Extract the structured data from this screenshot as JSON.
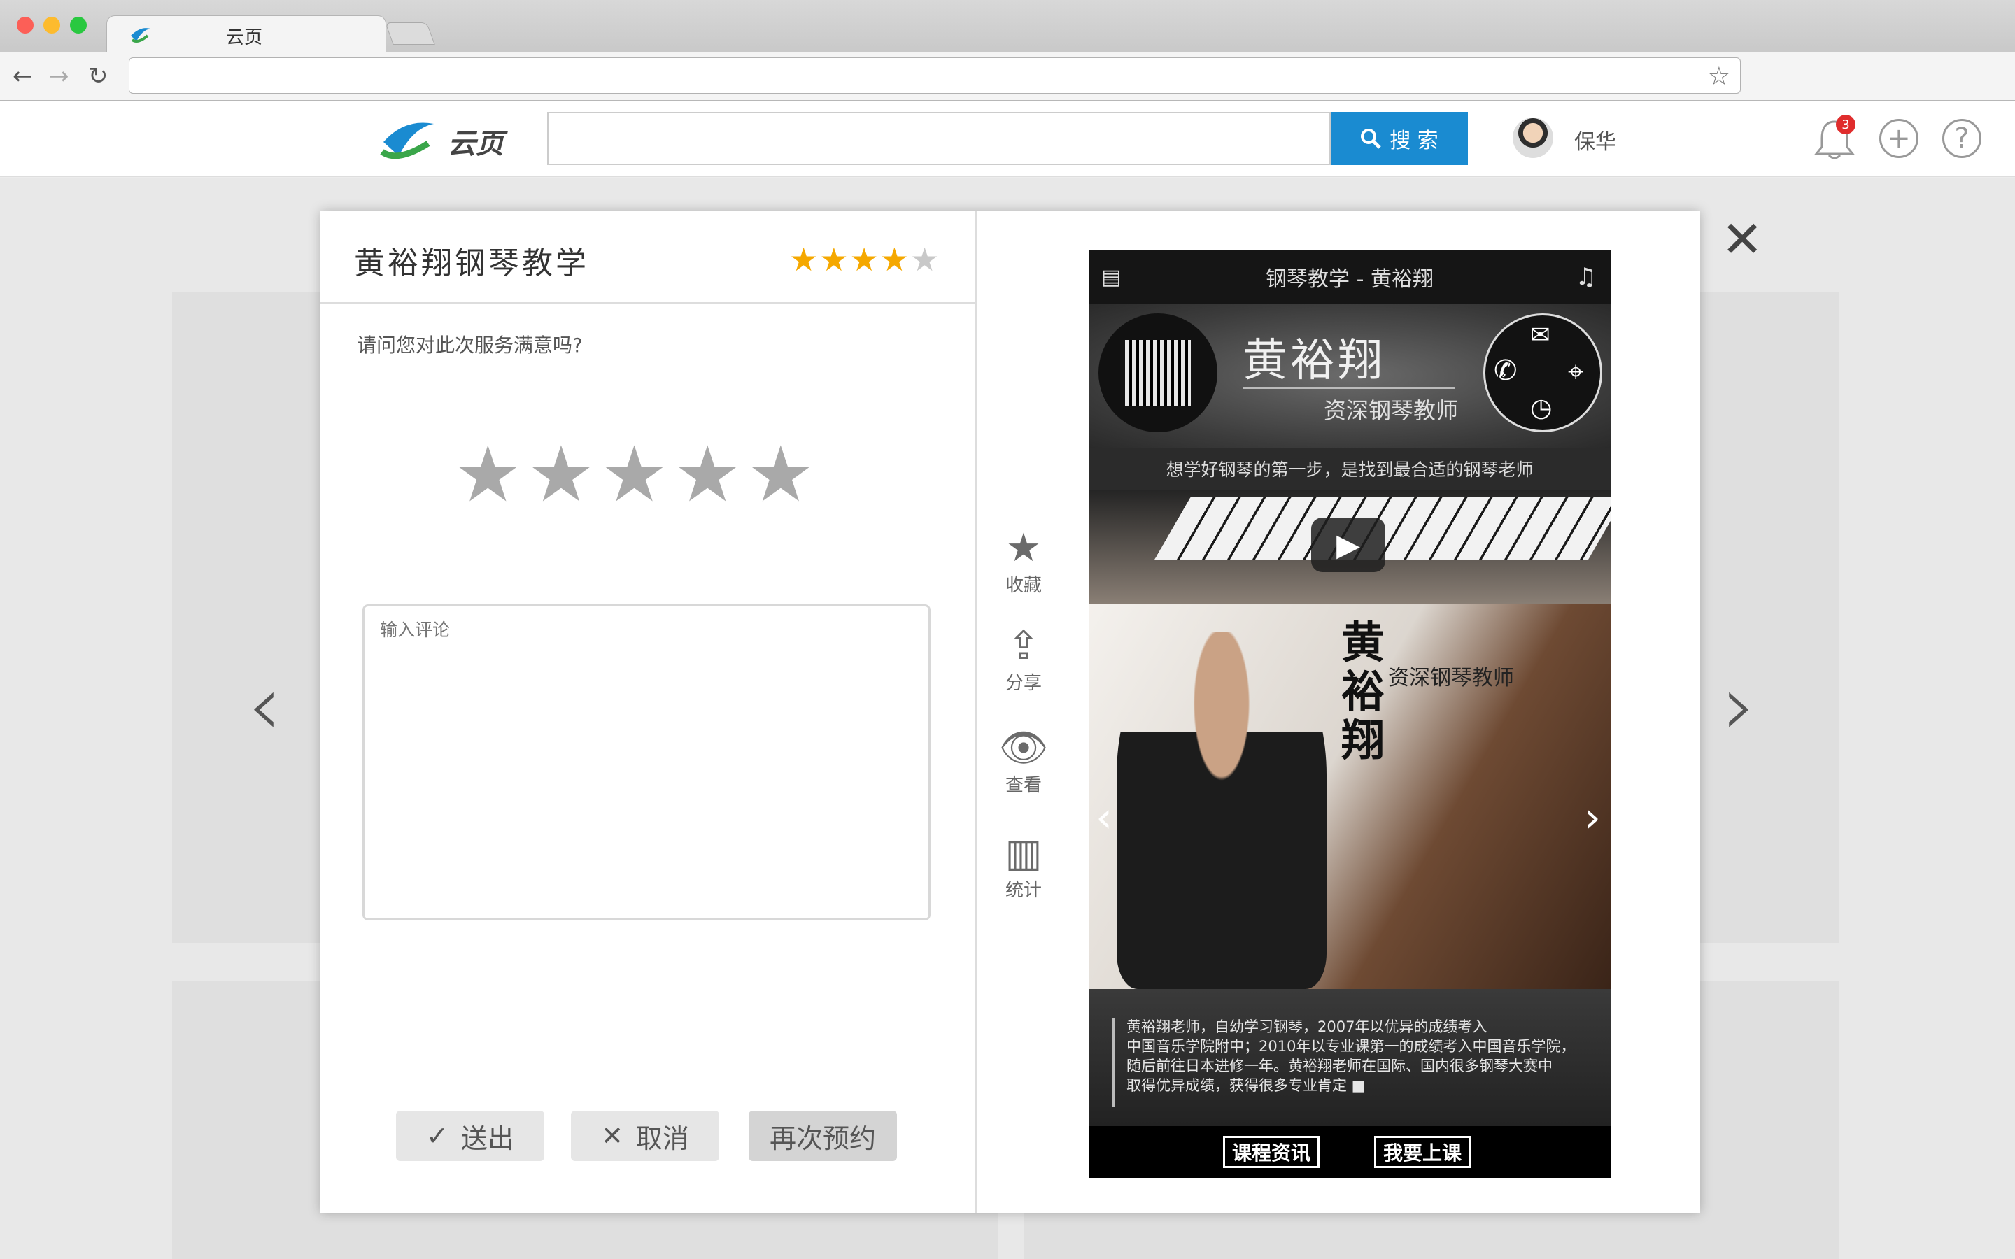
{
  "browser": {
    "tab_title": "云页",
    "url": ""
  },
  "header": {
    "logo_text": "云页",
    "search_placeholder": "",
    "search_button": "搜 索",
    "user_name": "保华",
    "notification_count": "3",
    "add_icon": "+",
    "help_icon": "?"
  },
  "dialog": {
    "title": "黄裕翔钢琴教学",
    "rating_filled": "★★★★",
    "rating_empty": "★",
    "question": "请问您对此次服务满意吗?",
    "stars": "★★★★★",
    "comment_placeholder": "输入评论",
    "buttons": {
      "send": "送出",
      "cancel": "取消",
      "rebook": "再次预约"
    }
  },
  "actions": [
    {
      "label": "收藏",
      "icon": "star-icon"
    },
    {
      "label": "分享",
      "icon": "share-icon"
    },
    {
      "label": "查看",
      "icon": "eye-icon"
    },
    {
      "label": "统计",
      "icon": "stats-icon"
    }
  ],
  "preview": {
    "header_title": "钢琴教学 - 黄裕翔",
    "name": "黄裕翔",
    "role": "资深钢琴教师",
    "tagline": "想学好钢琴的第一步，是找到最合适的钢琴老师",
    "vertical_name": "黄裕翔",
    "vertical_role": "资深钢琴教师",
    "description": "黄裕翔老师，自幼学习钢琴，2007年以优异的成绩考入\n中国音乐学院附中；2010年以专业课第一的成绩考入中国音乐学院，\n随后前往日本进修一年。黄裕翔老师在国际、国内很多钢琴大赛中\n取得优异成绩，获得很多专业肯定 ■",
    "btn_course": "课程资讯",
    "btn_join": "我要上课"
  },
  "colors": {
    "accent": "#1a8bd1",
    "star_gold": "#f5a800",
    "star_grey": "#a9a9a9",
    "badge_red": "#e02d2d"
  }
}
